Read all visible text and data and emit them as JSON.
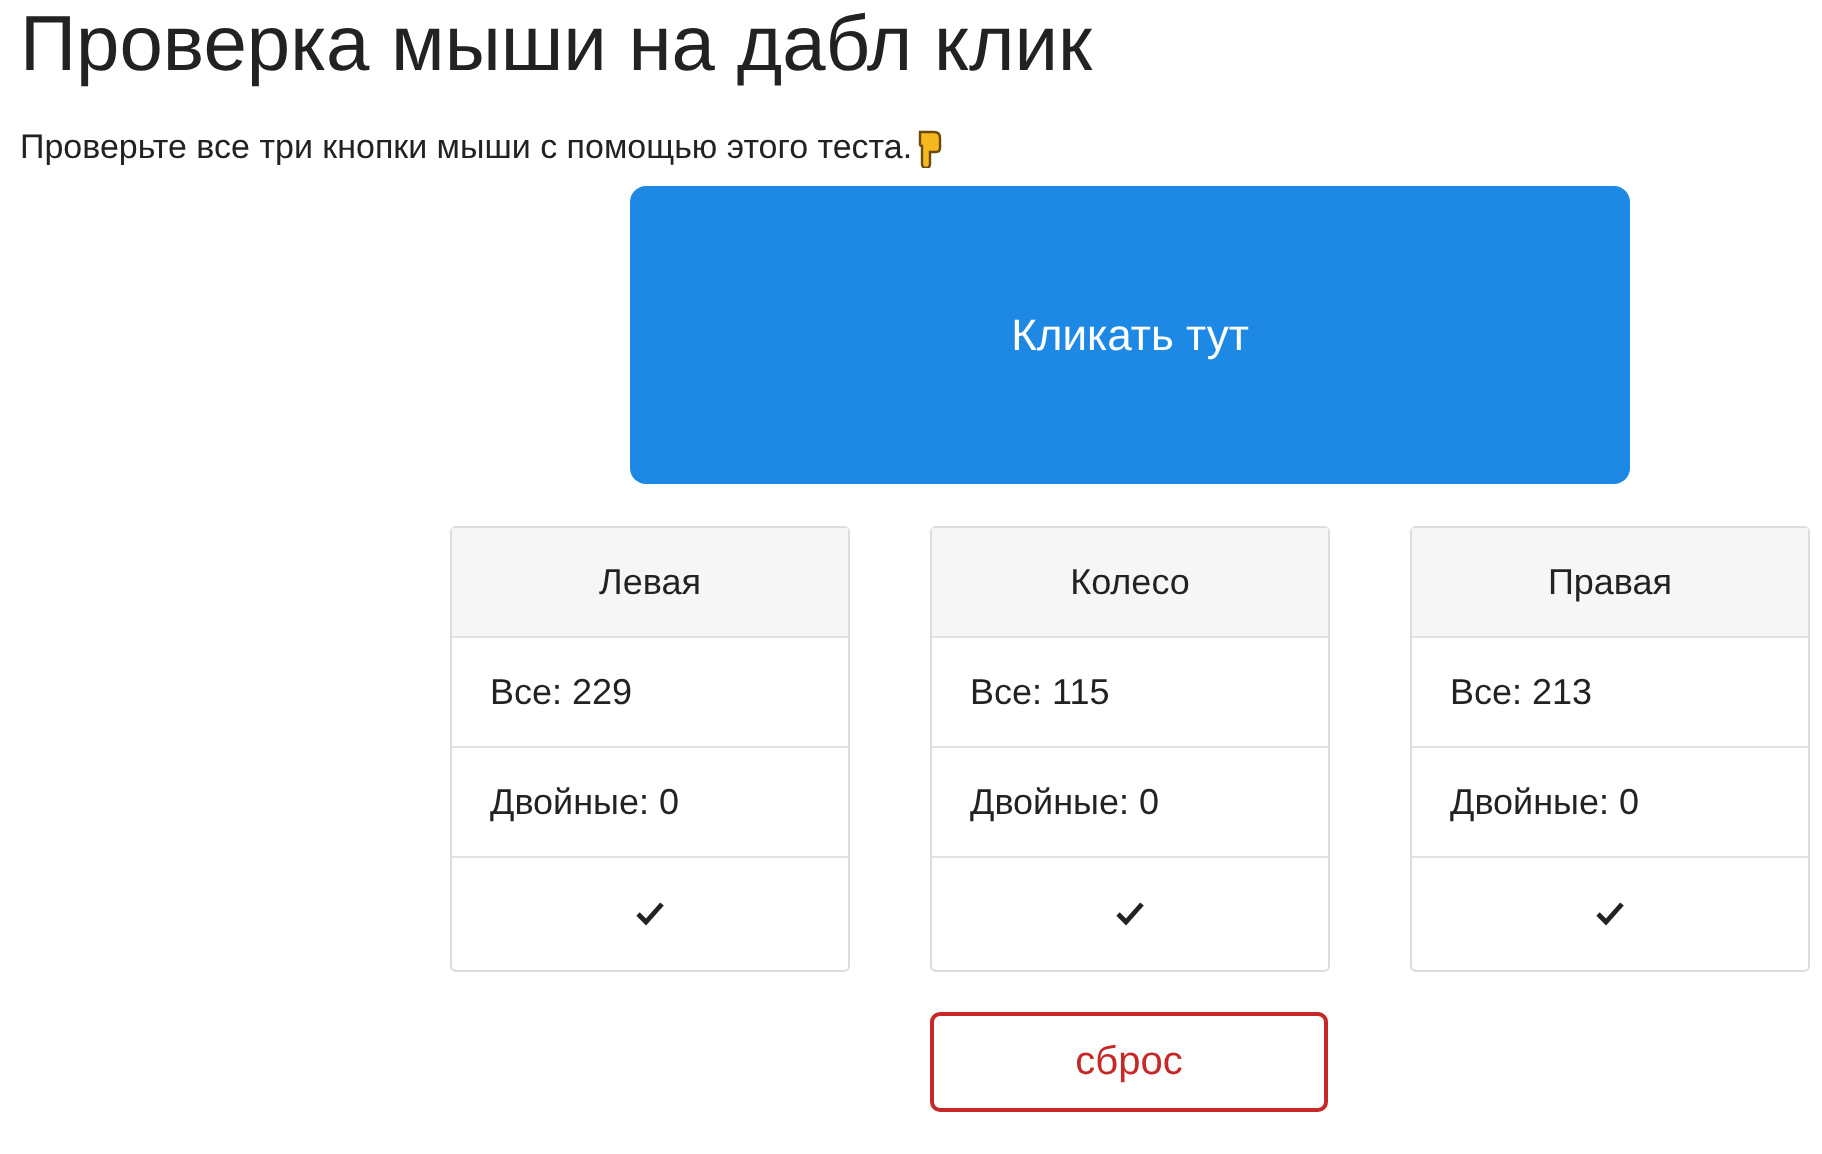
{
  "title": "Проверка мыши на дабл клик",
  "subtitle": "Проверьте все три кнопки мыши с помощью этого теста.",
  "click_area": {
    "label": "Кликать тут"
  },
  "buttons": [
    {
      "name": "Левая",
      "total": "Все: 229",
      "double": "Двойные: 0",
      "ok": true
    },
    {
      "name": "Колесо",
      "total": "Все: 115",
      "double": "Двойные: 0",
      "ok": true
    },
    {
      "name": "Правая",
      "total": "Все: 213",
      "double": "Двойные: 0",
      "ok": true
    }
  ],
  "reset": {
    "label": "сброс"
  }
}
